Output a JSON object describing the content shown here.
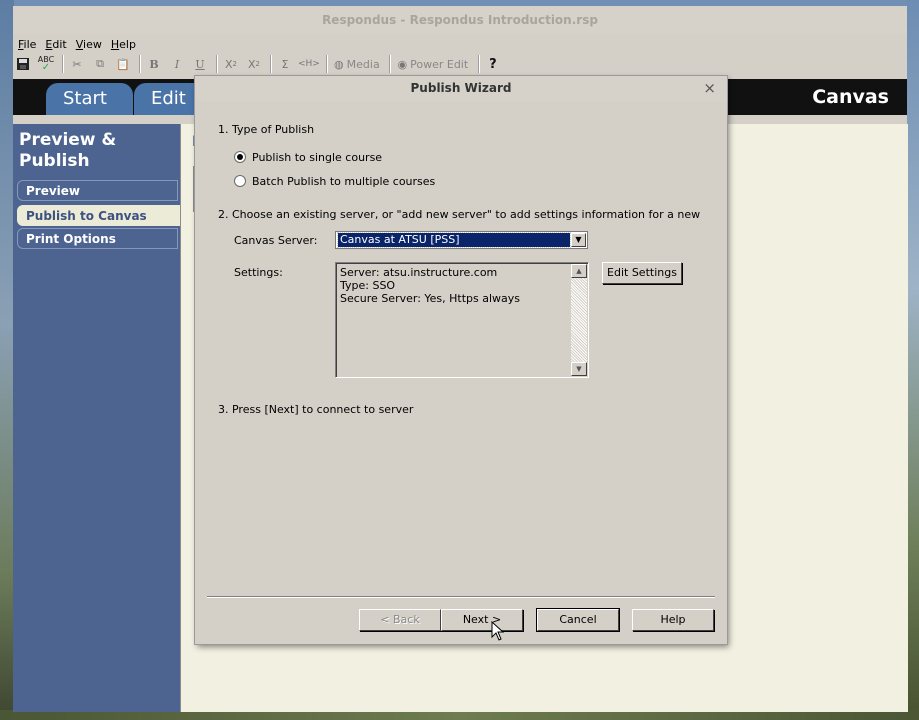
{
  "window": {
    "title": "Respondus - Respondus Introduction.rsp"
  },
  "menu": [
    {
      "label": "File",
      "key": "F"
    },
    {
      "label": "Edit",
      "key": "E"
    },
    {
      "label": "View",
      "key": "V"
    },
    {
      "label": "Help",
      "key": "H"
    }
  ],
  "toolbar": {
    "media_label": "Media",
    "power_edit_label": "Power Edit"
  },
  "tabs": {
    "start": "Start",
    "edit": "Edit"
  },
  "brand": "Canvas",
  "sidebar": {
    "title": "Preview & Publish",
    "items": [
      {
        "label": "Preview",
        "active": false
      },
      {
        "label": "Publish to Canvas",
        "active": true
      },
      {
        "label": "Print Options",
        "active": false
      }
    ]
  },
  "dialog": {
    "title": "Publish Wizard",
    "step1": "1.  Type of Publish",
    "radio_single": "Publish to single course",
    "radio_batch": "Batch Publish to multiple courses",
    "step2": "2.  Choose an existing server, or \"add new server\" to add settings information for a new",
    "server_label": "Canvas Server:",
    "server_value": "Canvas at ATSU [PSS]",
    "settings_label": "Settings:",
    "settings_lines": [
      "Server: atsu.instructure.com",
      "Type: SSO",
      "Secure Server: Yes, Https always"
    ],
    "edit_settings": "Edit Settings",
    "step3": "3.  Press [Next] to connect to server",
    "back": "< Back",
    "next": "Next >",
    "cancel": "Cancel",
    "help": "Help"
  },
  "colors": {
    "sidebar": "#4d6390",
    "tab": "#4a73a8",
    "selection": "#0a246a"
  }
}
